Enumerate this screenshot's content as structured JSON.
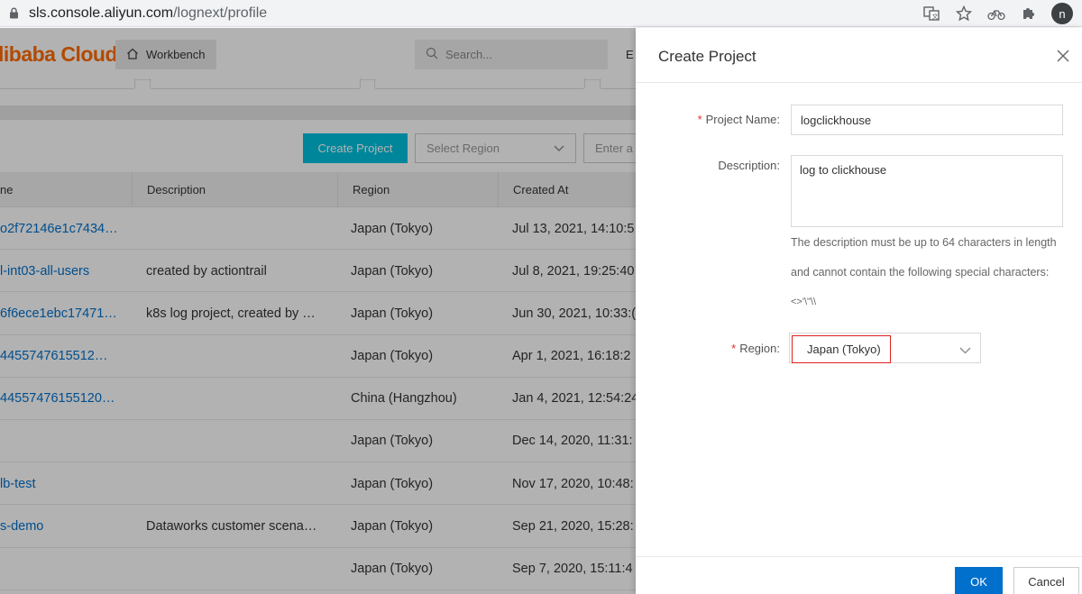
{
  "browser": {
    "url_host": "sls.console.aliyun.com",
    "url_path": "/lognext/profile",
    "avatar_letter": "n"
  },
  "nav": {
    "logo": "libaba Cloud",
    "workbench_label": "Workbench",
    "search_placeholder": "Search...",
    "truncated_item": "E"
  },
  "toolbar": {
    "create_project_label": "Create Project",
    "select_region_placeholder": "Select Region",
    "enter_placeholder": "Enter a"
  },
  "table": {
    "headers": {
      "name": "ne",
      "description": "Description",
      "region": "Region",
      "created_at": "Created At"
    },
    "rows": [
      {
        "name": "o2f72146e1c7434…",
        "description": "",
        "region": "Japan (Tokyo)",
        "created": "Jul 13, 2021, 14:10:5"
      },
      {
        "name": "l-int03-all-users",
        "description": "created by actiontrail",
        "region": "Japan (Tokyo)",
        "created": "Jul 8, 2021, 19:25:40"
      },
      {
        "name": "6f6ece1ebc17471…",
        "description": "k8s log project, created by …",
        "region": "Japan (Tokyo)",
        "created": "Jun 30, 2021, 10:33:("
      },
      {
        "name": "4455747615512…",
        "description": "",
        "region": "Japan (Tokyo)",
        "created": "Apr 1, 2021, 16:18:2"
      },
      {
        "name": "44557476155120…",
        "description": "",
        "region": "China (Hangzhou)",
        "created": "Jan 4, 2021, 12:54:24"
      },
      {
        "name": "",
        "description": "",
        "region": "Japan (Tokyo)",
        "created": "Dec 14, 2020, 11:31:"
      },
      {
        "name": "lb-test",
        "description": "",
        "region": "Japan (Tokyo)",
        "created": "Nov 17, 2020, 10:48:"
      },
      {
        "name": "s-demo",
        "description": "Dataworks customer scena…",
        "region": "Japan (Tokyo)",
        "created": "Sep 21, 2020, 15:28:"
      },
      {
        "name": "",
        "description": "",
        "region": "Japan (Tokyo)",
        "created": "Sep 7, 2020, 15:11:4"
      }
    ]
  },
  "drawer": {
    "title": "Create Project",
    "project_name_label": "Project Name:",
    "project_name_value": "logclickhouse",
    "description_label": "Description:",
    "description_value": "log to clickhouse",
    "help_line1": "The description must be up to 64 characters in length",
    "help_line2": "and cannot contain the following special characters:",
    "help_line3": "<>'\\\"\\\\",
    "region_label": "Region:",
    "region_value": "Japan (Tokyo)",
    "required_mark": "*",
    "ok_label": "OK",
    "cancel_label": "Cancel"
  },
  "colors": {
    "accent": "#00c1de",
    "link": "#0070cc",
    "brand": "#ff6a00",
    "highlight": "#e02020"
  }
}
